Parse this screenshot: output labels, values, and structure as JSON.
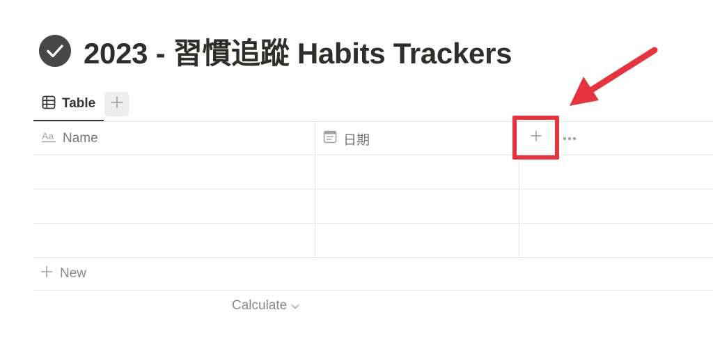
{
  "page": {
    "title": "2023 - 習慣追蹤 Habits Trackers",
    "title_icon": "check-circle-icon"
  },
  "views": {
    "tabs": [
      {
        "label": "Table",
        "icon": "table-icon",
        "active": true
      }
    ],
    "add_view_icon": "plus-icon"
  },
  "table": {
    "columns": [
      {
        "label": "Name",
        "icon": "text-aa-icon"
      },
      {
        "label": "日期",
        "icon": "calendar-icon"
      }
    ],
    "add_property_icon": "plus-icon",
    "more_icon": "ellipsis-icon",
    "rows": [
      {
        "name": "",
        "date": ""
      },
      {
        "name": "",
        "date": ""
      },
      {
        "name": "",
        "date": ""
      }
    ],
    "new_label": "New",
    "calculate_label": "Calculate"
  },
  "annotation": {
    "highlight_color": "#e5343e",
    "arrow_color": "#e5343e"
  }
}
